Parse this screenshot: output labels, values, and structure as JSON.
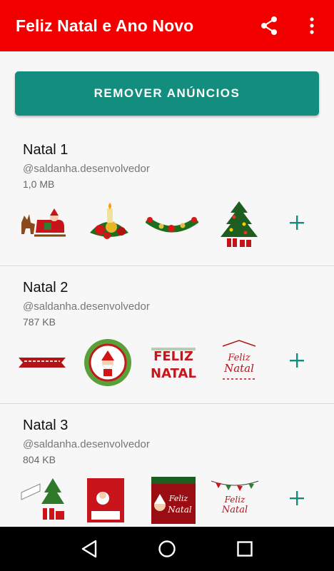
{
  "appbar": {
    "title": "Feliz Natal e Ano Novo",
    "background": "#f20000",
    "icons": [
      "share-icon",
      "more-vert-icon"
    ]
  },
  "remove_ads": {
    "label": "REMOVER ANÚNCIOS",
    "color": "#138d7d"
  },
  "packs": [
    {
      "name": "Natal 1",
      "author": "@saldanha.desenvolvedor",
      "size": "1,0 MB",
      "stickers": [
        "santa-sleigh-sticker",
        "ornament-bouquet-sticker",
        "garland-sticker",
        "christmas-tree-sticker"
      ]
    },
    {
      "name": "Natal 2",
      "author": "@saldanha.desenvolvedor",
      "size": "787 KB",
      "stickers": [
        "ribbon-banner-sticker",
        "santa-wreath-sticker",
        "feliz-natal-letters-sticker",
        "feliz-natal-script-sticker"
      ]
    },
    {
      "name": "Natal 3",
      "author": "@saldanha.desenvolvedor",
      "size": "804 KB",
      "stickers": [
        "tree-gifts-sticker",
        "santa-card-sticker",
        "feliz-natal-santa-sticker",
        "feliz-natal-bunting-sticker"
      ]
    }
  ],
  "add_color": "#138d7d",
  "navbar": {
    "icons": [
      "back-icon",
      "home-icon",
      "recents-icon"
    ]
  }
}
